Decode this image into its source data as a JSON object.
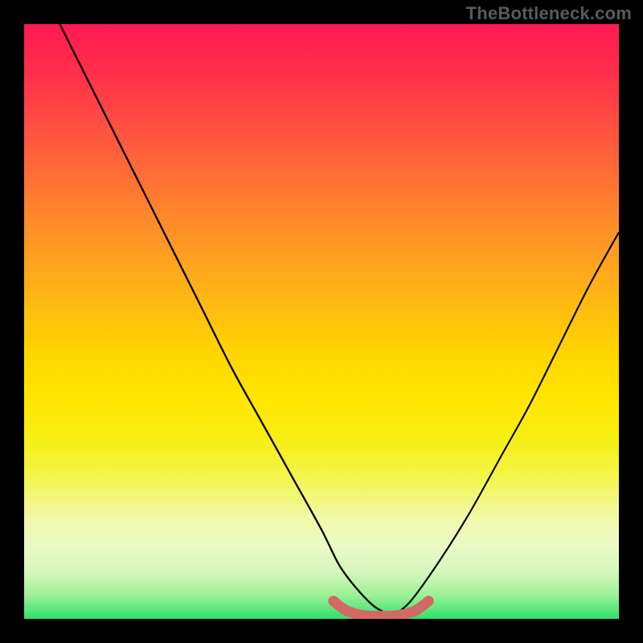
{
  "watermark": "TheBottleneck.com",
  "colors": {
    "black": "#000000",
    "curve": "#000000",
    "highlight": "#d06a62",
    "gradient_stops": [
      "#ff1a52",
      "#ff2e4a",
      "#ff5a3e",
      "#ff8a2a",
      "#ffb317",
      "#ffd400",
      "#ffe600",
      "#f7ef15",
      "#f3f54a",
      "#f2f9a8",
      "#eaf9c7",
      "#d6f7bd",
      "#9ef098",
      "#2fe06b"
    ]
  },
  "chart_data": {
    "type": "line",
    "title": "",
    "xlabel": "",
    "ylabel": "",
    "xlim": [
      0,
      100
    ],
    "ylim": [
      0,
      100
    ],
    "series": [
      {
        "name": "left-curve",
        "x": [
          6,
          10,
          15,
          20,
          25,
          30,
          35,
          40,
          45,
          50,
          53,
          56,
          59,
          62
        ],
        "values": [
          100,
          92,
          82,
          72,
          62,
          52,
          42,
          33,
          24,
          15,
          9,
          5,
          2,
          0.5
        ]
      },
      {
        "name": "right-curve",
        "x": [
          62,
          65,
          70,
          75,
          80,
          85,
          90,
          95,
          100
        ],
        "values": [
          0.5,
          3,
          10,
          18,
          27,
          36,
          46,
          56,
          65
        ]
      },
      {
        "name": "bottom-highlight",
        "x": [
          52,
          54,
          56,
          58,
          60,
          62,
          64,
          66,
          68
        ],
        "values": [
          3,
          1.5,
          0.8,
          0.5,
          0.5,
          0.5,
          0.8,
          1.5,
          3
        ]
      }
    ]
  }
}
